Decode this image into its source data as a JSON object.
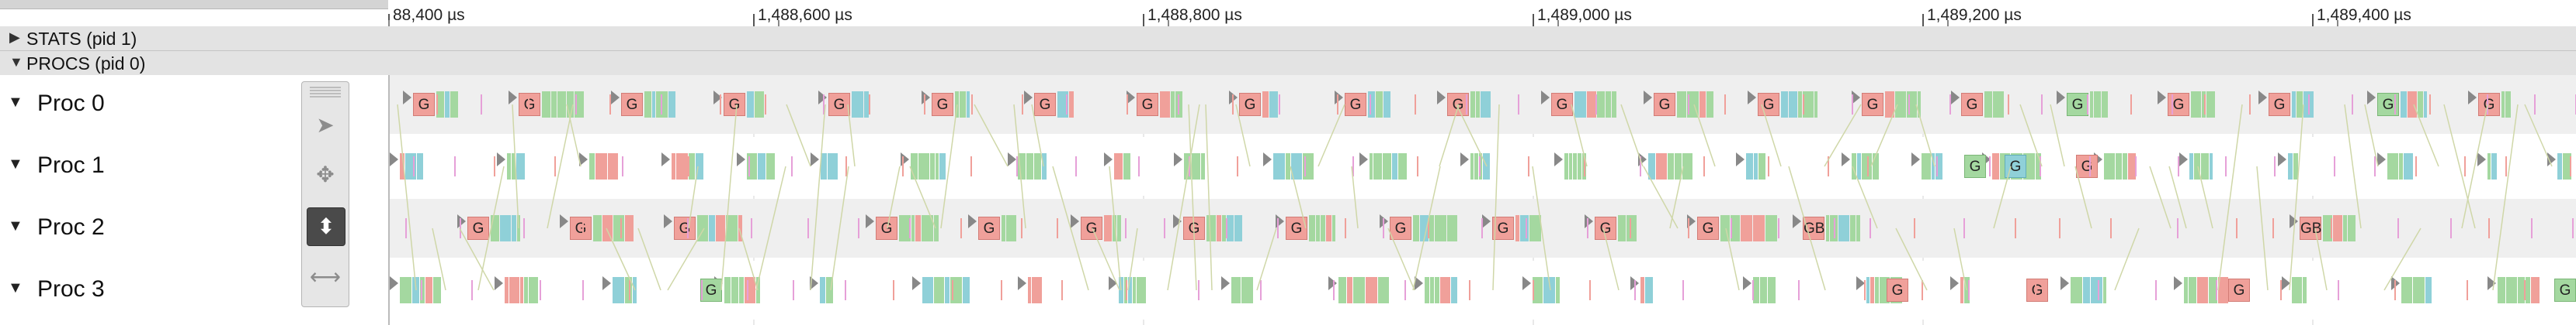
{
  "ruler": {
    "labels": [
      "88,400 µs",
      "1,488,600 µs",
      "1,488,800 µs",
      "1,489,000 µs",
      "1,489,200 µs",
      "1,489,400 µs"
    ]
  },
  "process_groups": [
    {
      "label": "STATS (pid 1)",
      "expanded": false
    },
    {
      "label": "PROCS (pid 0)",
      "expanded": true
    }
  ],
  "threads": [
    {
      "name": "Proc 0"
    },
    {
      "name": "Proc 1"
    },
    {
      "name": "Proc 2"
    },
    {
      "name": "Proc 3"
    }
  ],
  "glyphs": {
    "expanded": "▼",
    "collapsed": "▶"
  },
  "marker_text": {
    "g": "G",
    "gb": "GB"
  },
  "toolbox": {
    "tools": [
      {
        "icon": "pointer-icon",
        "glyph": "➤",
        "active": false
      },
      {
        "icon": "pan-icon",
        "glyph": "✥",
        "active": false
      },
      {
        "icon": "zoom-icon",
        "glyph": "⬍",
        "active": true
      },
      {
        "icon": "timing-icon",
        "glyph": "⟷",
        "active": false
      }
    ]
  },
  "colors": {
    "green": "#a4d8a0",
    "red": "#f0a09a",
    "teal": "#8fd0d8",
    "pink": "#e6a0d8",
    "flow_line": "#cfd7a8",
    "row_alt": "#efefef"
  }
}
